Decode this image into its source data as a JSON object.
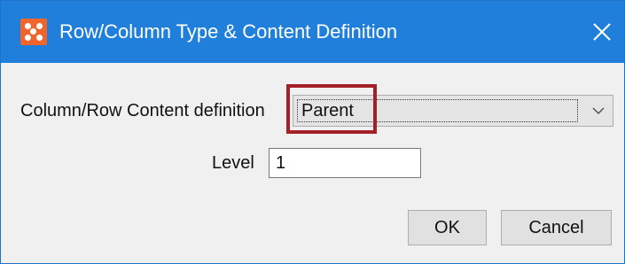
{
  "window": {
    "title": "Row/Column Type & Content Definition",
    "accent_color": "#1f7fdb",
    "icon_color": "#f2652a",
    "icons": {
      "app": "app-logo-icon",
      "close": "close-icon",
      "dropdown": "chevron-down-icon"
    }
  },
  "form": {
    "content_definition": {
      "label": "Column/Row Content definition",
      "selected": "Parent",
      "highlight_color": "#a32028"
    },
    "level": {
      "label": "Level",
      "value": "1"
    }
  },
  "buttons": {
    "ok": "OK",
    "cancel": "Cancel"
  }
}
